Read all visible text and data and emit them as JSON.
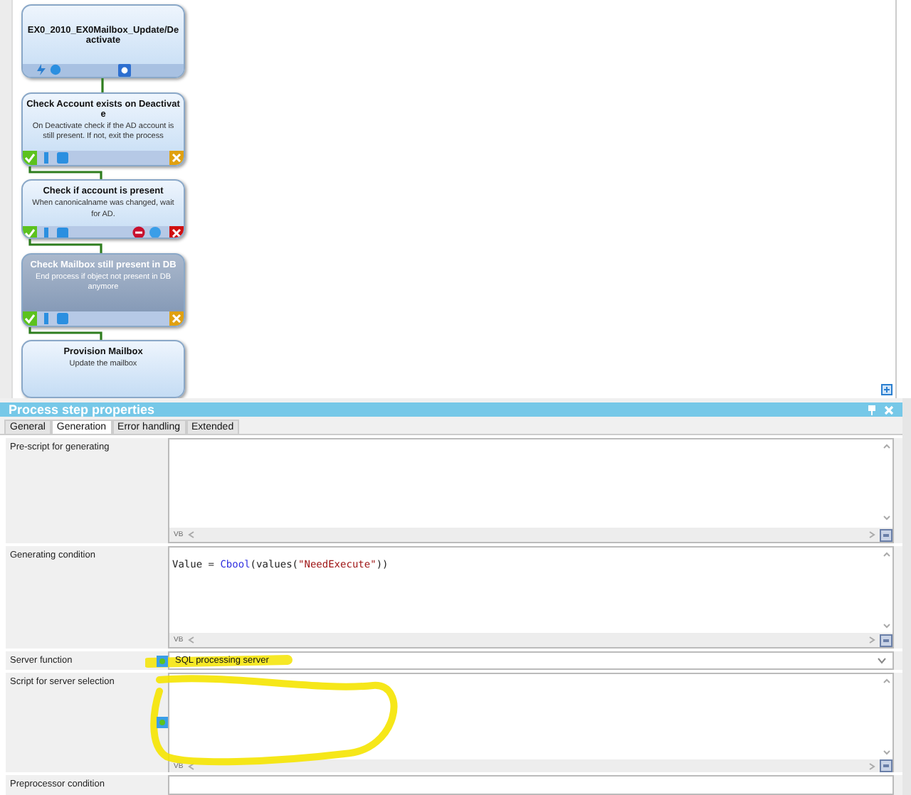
{
  "process_nodes": [
    {
      "kind": "start",
      "title": "EX0_2010_EX0Mailbox_Update/Deactivate",
      "selected": false
    },
    {
      "kind": "step",
      "title": "Check Account exists on Deactivate",
      "description": "On Deactivate check if the AD account is still present. If not, exit the process",
      "selected": false
    },
    {
      "kind": "error_step",
      "title": "Check if account is present",
      "description": "When canonicalname was changed, wait for AD.",
      "selected": false
    },
    {
      "kind": "step",
      "title": "Check Mailbox still present in DB",
      "description": "End process if object not present in DB anymore",
      "selected": true
    },
    {
      "kind": "partial",
      "title": "Provision Mailbox",
      "description": "Update the mailbox",
      "selected": false
    }
  ],
  "panel": {
    "title": "Process step properties",
    "tabs": [
      {
        "label": "General",
        "selected": false
      },
      {
        "label": "Generation",
        "selected": true
      },
      {
        "label": "Error handling",
        "selected": false
      },
      {
        "label": "Extended",
        "selected": false
      }
    ],
    "fields": [
      {
        "kind": "script",
        "label": "Pre-script for generating",
        "language": "VB"
      },
      {
        "kind": "script",
        "label": "Generating condition",
        "language": "VB",
        "tokens": [
          {
            "kind": "plain",
            "text": "Value = "
          },
          {
            "kind": "function",
            "text": "Cbool"
          },
          {
            "kind": "plain",
            "text": "(values("
          },
          {
            "kind": "string",
            "text": "\"NeedExecute\""
          },
          {
            "kind": "plain",
            "text": "))"
          }
        ]
      },
      {
        "kind": "dropdown",
        "label": "Server function",
        "value": "SQL processing server"
      },
      {
        "kind": "server_script",
        "label": "Script for server selection",
        "language": "VB"
      },
      {
        "kind": "partial",
        "label": "Preprocessor condition"
      }
    ]
  }
}
